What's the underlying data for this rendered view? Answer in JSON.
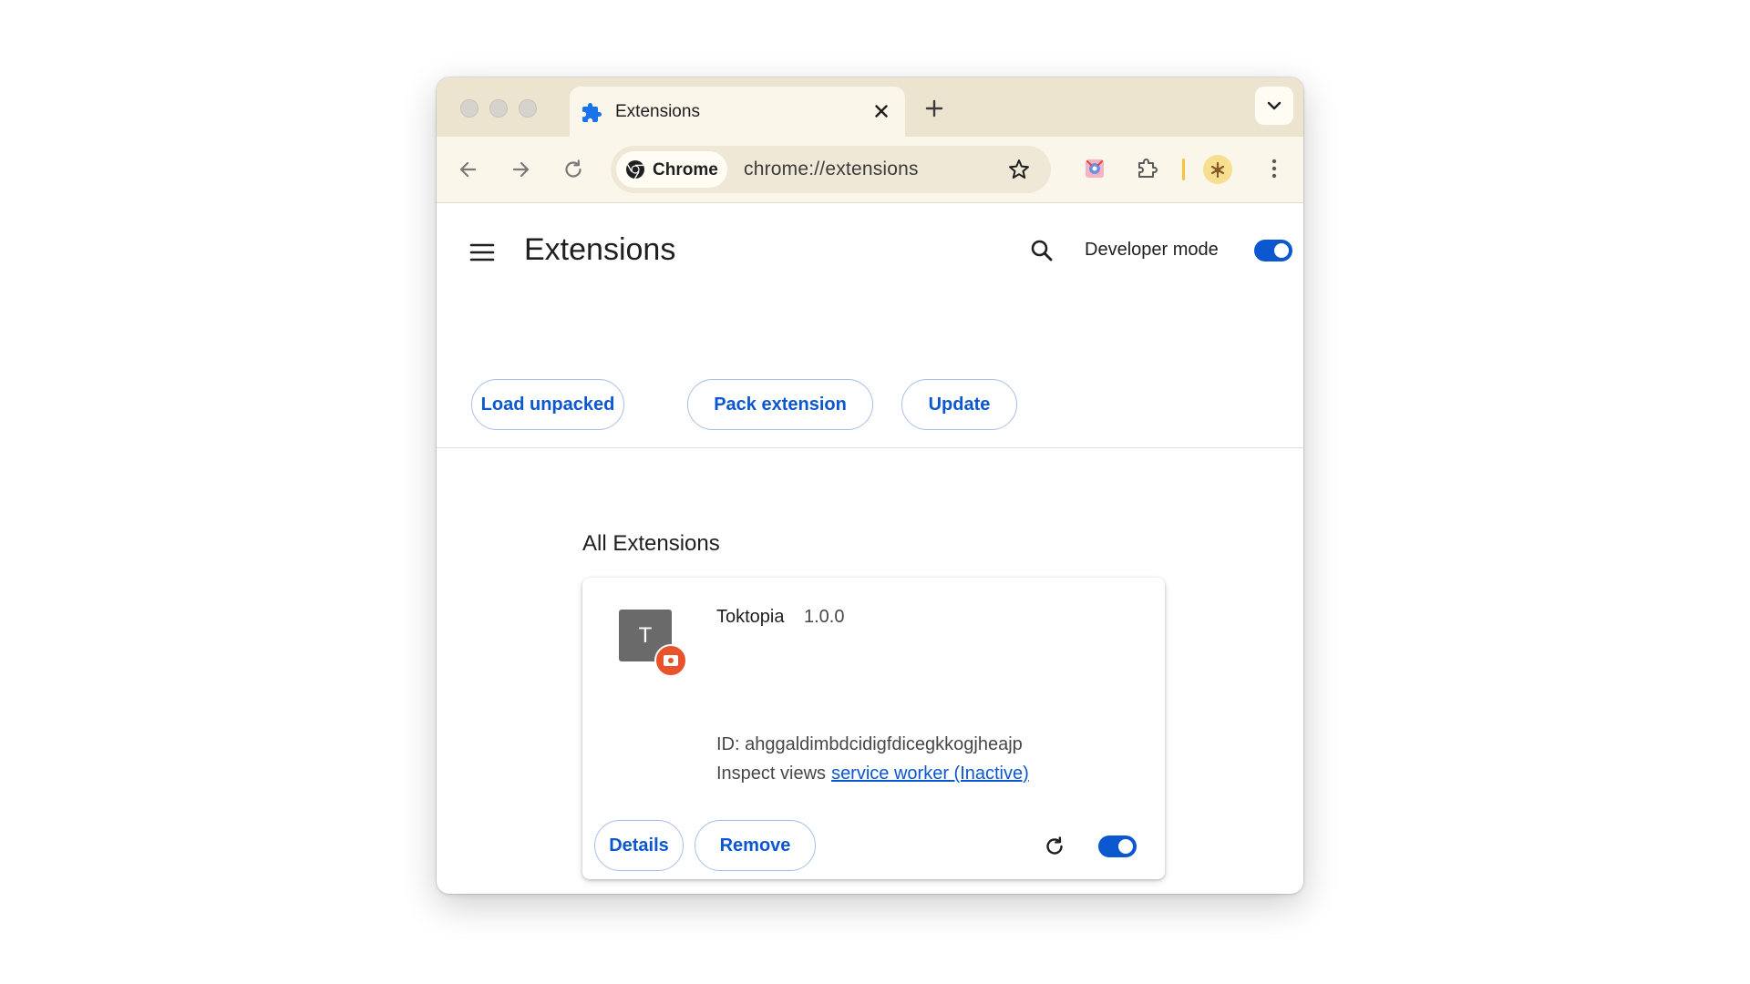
{
  "tab": {
    "title": "Extensions"
  },
  "omnibox": {
    "chip_label": "Chrome",
    "url": "chrome://extensions"
  },
  "header": {
    "title": "Extensions",
    "developer_mode_label": "Developer mode",
    "developer_mode_on": true
  },
  "actions": {
    "load_unpacked": "Load unpacked",
    "pack_extension": "Pack extension",
    "update": "Update"
  },
  "section_title": "All Extensions",
  "extension": {
    "logo_letter": "T",
    "name": "Toktopia",
    "version": "1.0.0",
    "id_text": "ID: ahggaldimbdcidigfdicegkkogjheajp",
    "inspect_label": "Inspect views",
    "inspect_link": "service worker (Inactive)",
    "details_label": "Details",
    "remove_label": "Remove",
    "enabled": true
  },
  "colors": {
    "accent": "#0b57d0",
    "tabstrip": "#ede4cf",
    "toolbar": "#fbf6ea",
    "badge": "#e8532b"
  },
  "icons": [
    "puzzle-icon",
    "close-icon",
    "plus-icon",
    "chevron-down-icon",
    "back-arrow-icon",
    "forward-arrow-icon",
    "reload-icon",
    "chrome-logo-icon",
    "star-icon",
    "extension-icon",
    "puzzle-outline-icon",
    "avatar",
    "kebab-menu-icon",
    "hamburger-menu-icon",
    "search-icon"
  ]
}
